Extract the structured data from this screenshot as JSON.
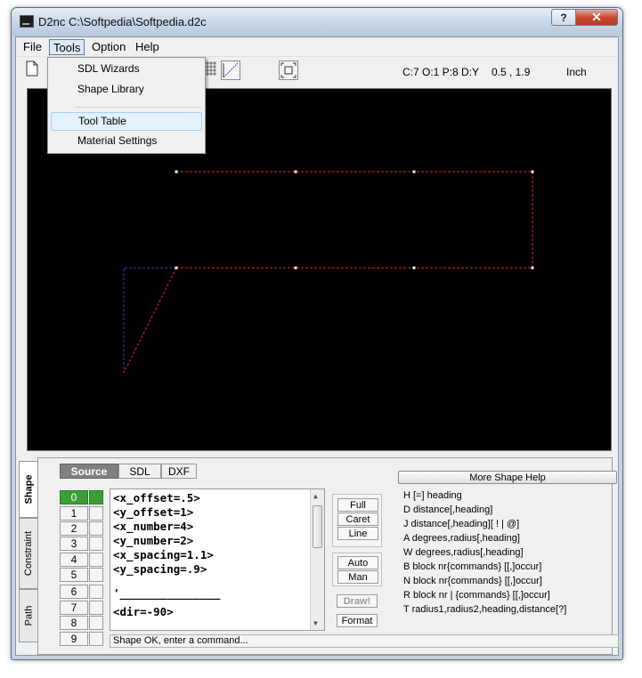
{
  "window": {
    "title": "D2nc C:\\Softpedia\\Softpedia.d2c",
    "help_btn": "?",
    "close_btn": "✕"
  },
  "menu": {
    "items": [
      "File",
      "Tools",
      "Option",
      "Help"
    ],
    "open": "Tools",
    "tools_dropdown": [
      "SDL Wizards",
      "Shape Library",
      "Tool Table",
      "Material Settings"
    ],
    "hovered": "Tool Table"
  },
  "toolbar": {
    "readout": "C:7  O:1  P:8  D:Y",
    "coords": "0.5 , 1.9",
    "units": "Inch"
  },
  "side_tabs": [
    "Shape",
    "Constraint",
    "Path"
  ],
  "source_tabs": [
    "Source",
    "SDL",
    "DXF"
  ],
  "numbers": [
    "0",
    "1",
    "2",
    "3",
    "4",
    "5",
    "6",
    "7",
    "8",
    "9"
  ],
  "source_lines": [
    "<x_offset=.5>",
    "<y_offset=1>",
    "<x_number=4>",
    "<y_number=2>",
    "<x_spacing=1.1>",
    "<y_spacing=.9>",
    "",
    "'_______________",
    "",
    "<dir=-90>"
  ],
  "mode_buttons": [
    "Full",
    "Caret",
    "Line"
  ],
  "auto_buttons": [
    "Auto",
    "Man"
  ],
  "draw_button": "Draw!",
  "format_button": "Format",
  "help": {
    "button": "More Shape Help",
    "lines": [
      "H [=] heading",
      "D distance[,heading]",
      "J distance[,heading][ ! | @]",
      "A degrees,radius[,heading]",
      "W degrees,radius[,heading]",
      "B block nr{commands} [[,]occur]",
      "N block nr{commands} [[,]occur]",
      "R block nr | {commands} [[,]occur]",
      "T radius1,radius2,heading,distance[?]"
    ]
  },
  "status": "Shape OK, enter a command...",
  "colors": {
    "canvas_bg": "#000000",
    "shape_line": "#e0202a",
    "path_line": "#2a3fd0",
    "active_number": "#3aa035"
  }
}
